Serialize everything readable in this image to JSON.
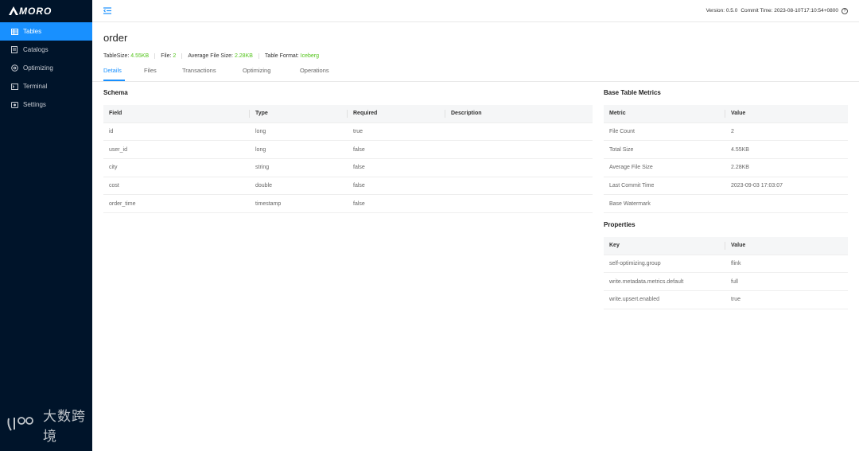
{
  "app": {
    "logo_text": "MORO",
    "logo_mark": "A"
  },
  "sidebar": {
    "items": [
      {
        "label": "Tables",
        "icon": "table-icon",
        "active": true
      },
      {
        "label": "Catalogs",
        "icon": "catalog-icon",
        "active": false
      },
      {
        "label": "Optimizing",
        "icon": "optimizing-icon",
        "active": false
      },
      {
        "label": "Terminal",
        "icon": "terminal-icon",
        "active": false
      },
      {
        "label": "Settings",
        "icon": "settings-icon",
        "active": false
      }
    ]
  },
  "header": {
    "version": "Version: 0.5.0",
    "commit_time": "Commit Time: 2023-08-10T17:10:54+0800"
  },
  "page": {
    "title": "order",
    "meta": {
      "table_size_label": "TableSize:",
      "table_size": "4.55KB",
      "file_label": "File:",
      "file": "2",
      "avg_file_size_label": "Average File Size:",
      "avg_file_size": "2.28KB",
      "format_label": "Table Format:",
      "format": "Iceberg"
    },
    "tabs": [
      "Details",
      "Files",
      "Transactions",
      "Optimizing",
      "Operations"
    ]
  },
  "schema": {
    "title": "Schema",
    "columns": [
      "Field",
      "Type",
      "Required",
      "Description"
    ],
    "rows": [
      [
        "id",
        "long",
        "true",
        ""
      ],
      [
        "user_id",
        "long",
        "false",
        ""
      ],
      [
        "city",
        "string",
        "false",
        ""
      ],
      [
        "cost",
        "double",
        "false",
        ""
      ],
      [
        "order_time",
        "timestamp",
        "false",
        ""
      ]
    ]
  },
  "metrics": {
    "title": "Base Table Metrics",
    "columns": [
      "Metric",
      "Value"
    ],
    "rows": [
      [
        "File Count",
        "2"
      ],
      [
        "Total Size",
        "4.55KB"
      ],
      [
        "Average File Size",
        "2.28KB"
      ],
      [
        "Last Commit Time",
        "2023-09-03 17:03:07"
      ],
      [
        "Base Watermark",
        ""
      ]
    ]
  },
  "properties": {
    "title": "Properties",
    "columns": [
      "Key",
      "Value"
    ],
    "rows": [
      [
        "self-optimizing.group",
        "flink"
      ],
      [
        "write.metadata.metrics.default",
        "full"
      ],
      [
        "write.upsert.enabled",
        "true"
      ]
    ]
  },
  "watermark": {
    "text": "大数跨境"
  },
  "colors": {
    "sidebar_bg": "#00142a",
    "accent": "#1890ff",
    "meta_value": "#52c41a"
  }
}
